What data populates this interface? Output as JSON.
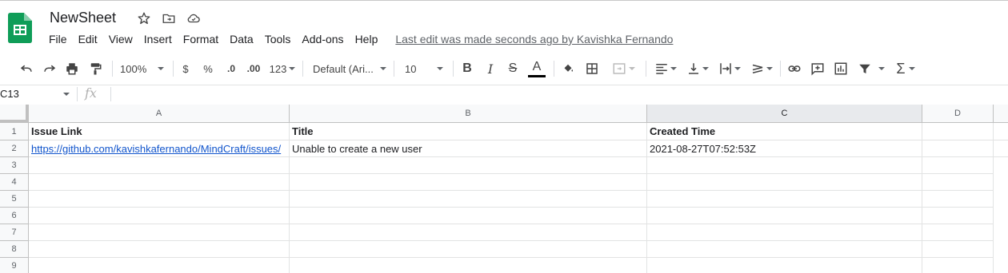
{
  "doc": {
    "name": "NewSheet"
  },
  "menu": [
    "File",
    "Edit",
    "View",
    "Insert",
    "Format",
    "Data",
    "Tools",
    "Add-ons",
    "Help"
  ],
  "last_edit": "Last edit was made seconds ago by Kavishka Fernando",
  "toolbar": {
    "zoom": "100%",
    "currency": "$",
    "percent": "%",
    "dec_decrease": ".0",
    "dec_increase": ".00",
    "more_formats": "123",
    "font": "Default (Ari...",
    "font_size": "10",
    "bold": "B",
    "italic": "I",
    "strike": "S",
    "text_color": "A"
  },
  "formula_bar": {
    "name_box": "C13",
    "fx": "fx",
    "value": ""
  },
  "grid": {
    "columns": [
      "A",
      "B",
      "C",
      "D"
    ],
    "rows": [
      "1",
      "2",
      "3",
      "4",
      "5",
      "6",
      "7",
      "8",
      "9"
    ],
    "cells": {
      "A1": "Issue Link",
      "B1": "Title",
      "C1": "Created Time",
      "A2": "https://github.com/kavishkafernando/MindCraft/issues/",
      "B2": "Unable to create a new user",
      "C2": "2021-08-27T07:52:53Z"
    }
  },
  "colors": {
    "sheets_green": "#0f9d58",
    "link": "#1155cc",
    "header_bg": "#f8f9fa"
  }
}
